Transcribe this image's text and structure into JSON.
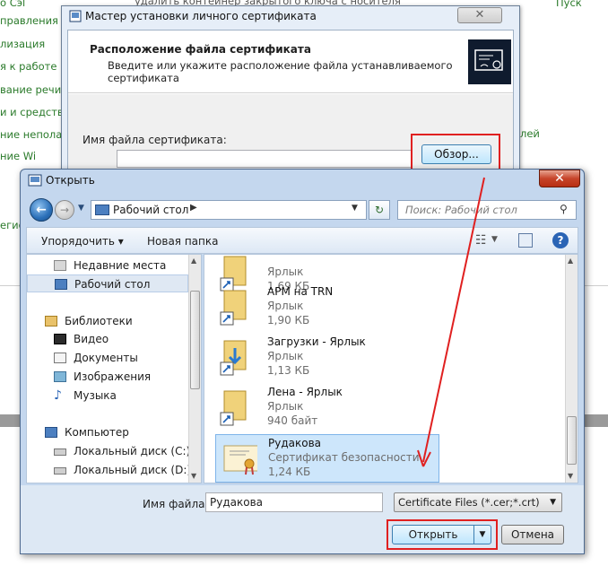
{
  "background": {
    "links": [
      "о Сэl",
      "правления Р",
      "лизация",
      "я к работе",
      "вание речи",
      "и и средства с",
      "ние неполадс",
      "ние Wi",
      "егиог"
    ],
    "right_link": "лей",
    "top_fragment": "удалить контейнер закрытого ключа с носителя",
    "right_top_fragment": "Пуск"
  },
  "wizard": {
    "title": "Мастер установки личного сертификата",
    "heading": "Расположение файла сертификата",
    "subheading": "Введите или укажите расположение файла устанавливаемого сертификата",
    "file_label": "Имя файла сертификата:",
    "file_value": "",
    "browse_label": "Обзор...",
    "close_glyph": "✕"
  },
  "open_dialog": {
    "title": "Открыть",
    "close_glyph": "✕",
    "address": "Рабочий стол",
    "search_placeholder": "Поиск: Рабочий стол",
    "toolbar": {
      "organize": "Упорядочить ▾",
      "new_folder": "Новая папка"
    },
    "nav": [
      {
        "label": "Недавние места",
        "icon": "recent-places-icon"
      },
      {
        "label": "Рабочий стол",
        "icon": "desktop-icon",
        "selected": true
      },
      {
        "label": "Библиотеки",
        "icon": "libraries-icon"
      },
      {
        "label": "Видео",
        "icon": "video-icon"
      },
      {
        "label": "Документы",
        "icon": "documents-icon"
      },
      {
        "label": "Изображения",
        "icon": "images-icon"
      },
      {
        "label": "Музыка",
        "icon": "music-icon"
      },
      {
        "label": "Компьютер",
        "icon": "computer-icon"
      },
      {
        "label": "Локальный диск (C:)",
        "icon": "disk-icon"
      },
      {
        "label": "Локальный диск (D:)",
        "icon": "disk-icon"
      }
    ],
    "files": [
      {
        "name": "",
        "type": "Ярлык",
        "size": "1,69 КБ",
        "icon": "folder-shortcut-icon"
      },
      {
        "name": "АРМ на TRN",
        "type": "Ярлык",
        "size": "1,90 КБ",
        "icon": "folder-shortcut-icon"
      },
      {
        "name": "Загрузки - Ярлык",
        "type": "Ярлык",
        "size": "1,13 КБ",
        "icon": "downloads-shortcut-icon"
      },
      {
        "name": "Лена - Ярлык",
        "type": "Ярлык",
        "size": "940 байт",
        "icon": "folder-shortcut-icon"
      },
      {
        "name": "Рудакова",
        "type": "Сертификат безопасности",
        "size": "1,24 КБ",
        "icon": "certificate-icon",
        "selected": true
      }
    ],
    "filename_label": "Имя файла:",
    "filename_value": "Рудакова",
    "filter_value": "Certificate Files (*.cer;*.crt)",
    "open_label": "Открыть",
    "cancel_label": "Отмена"
  },
  "colors": {
    "highlight_red": "#e02020",
    "link_green": "#2a7a2a",
    "selection_blue": "#cde6fb"
  }
}
